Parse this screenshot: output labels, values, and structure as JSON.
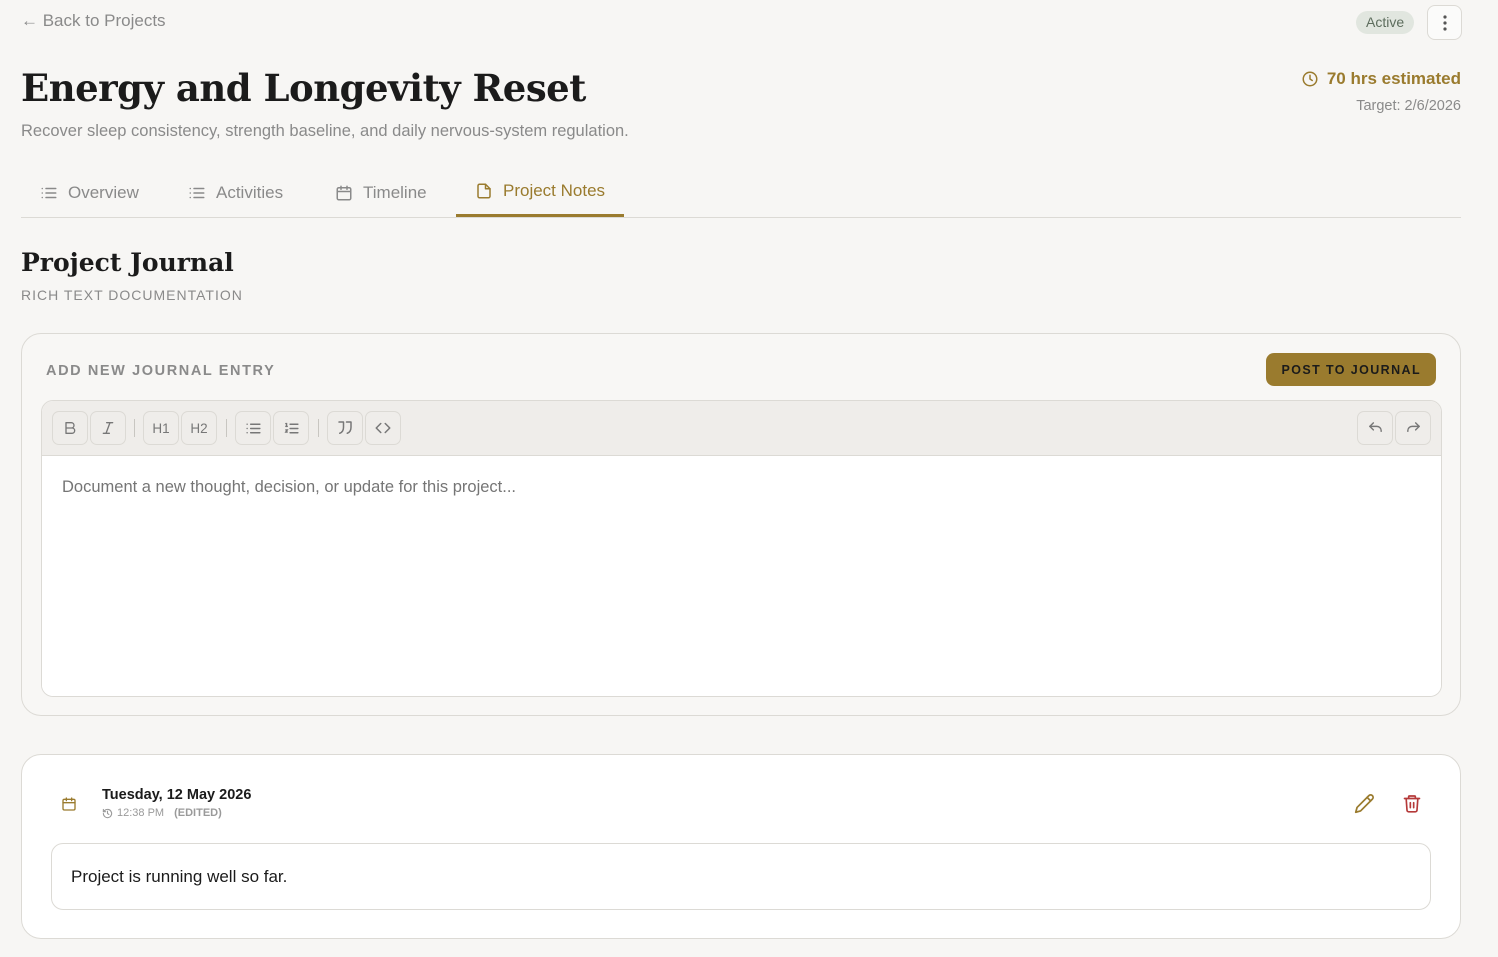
{
  "nav": {
    "back_label": "← Back to Projects"
  },
  "status": {
    "label": "Active"
  },
  "project": {
    "title": "Energy and Longevity Reset",
    "subtitle": "Recover sleep consistency, strength baseline, and daily nervous-system regulation.",
    "estimate": "70 hrs estimated",
    "target": "Target: 2/6/2026"
  },
  "tabs": [
    {
      "label": "Overview",
      "icon": "list-icon",
      "active": false
    },
    {
      "label": "Activities",
      "icon": "list-icon",
      "active": false
    },
    {
      "label": "Timeline",
      "icon": "calendar-icon",
      "active": false
    },
    {
      "label": "Project Notes",
      "icon": "document-icon",
      "active": true
    }
  ],
  "journal": {
    "title": "Project Journal",
    "subtitle": "RICH TEXT DOCUMENTATION",
    "new_entry_label": "ADD NEW JOURNAL ENTRY",
    "post_button": "POST TO JOURNAL",
    "placeholder": "Document a new thought, decision, or update for this project...",
    "toolbar": {
      "h1": "H1",
      "h2": "H2"
    }
  },
  "entries": [
    {
      "date": "Tuesday, 12 May 2026",
      "time": "12:38 PM",
      "edited": "(EDITED)",
      "body": "Project is running well so far."
    }
  ],
  "colors": {
    "accent": "#9a7b2e",
    "background": "#f7f6f4",
    "delete": "#b53a3a",
    "badge_bg": "#e1e6df"
  }
}
